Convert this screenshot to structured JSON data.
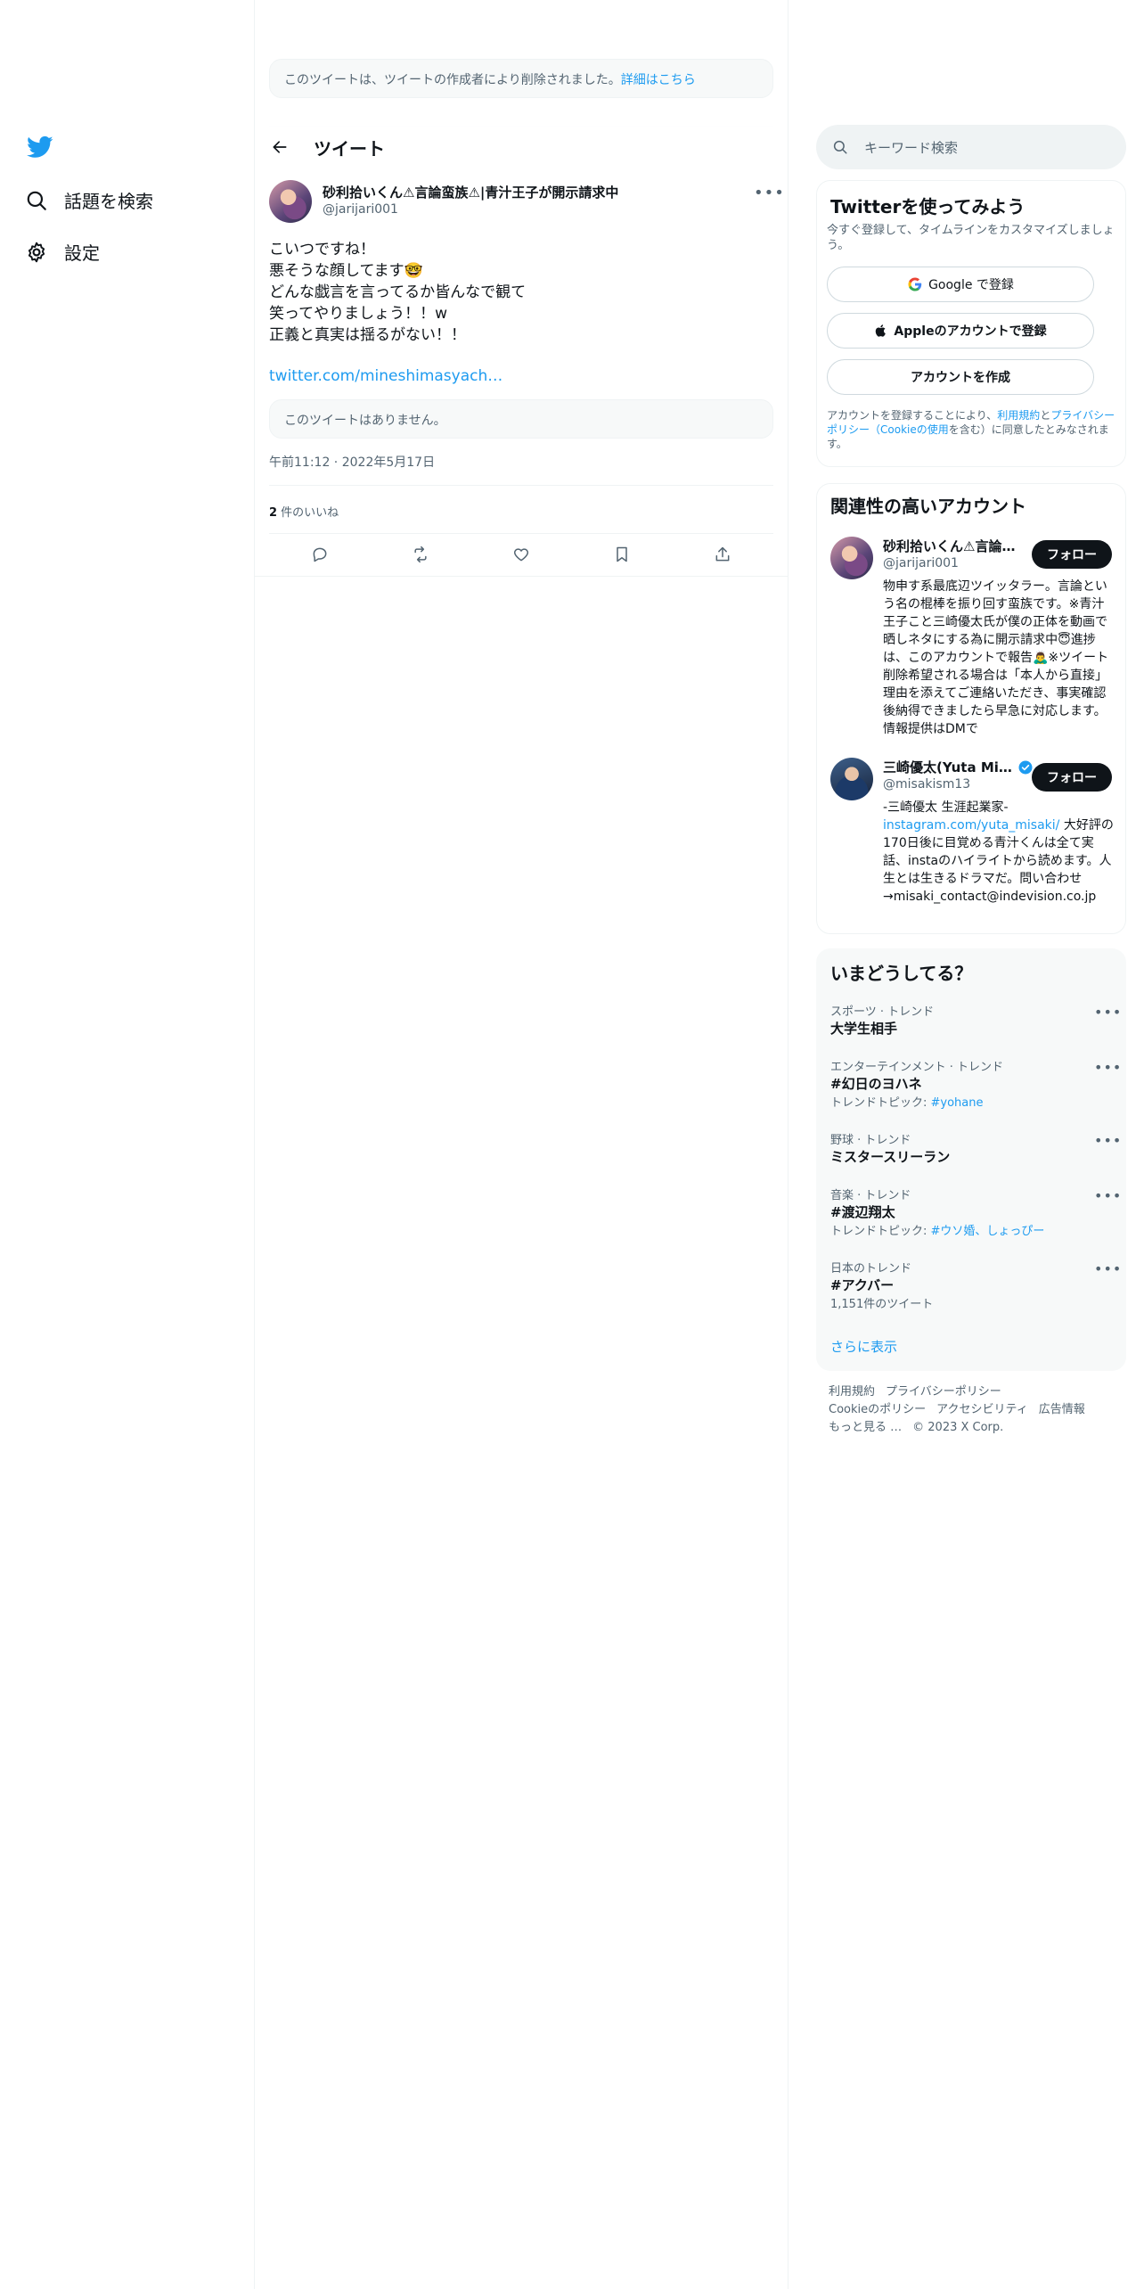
{
  "nav": {
    "logo_icon": "twitter-bird-icon",
    "items": [
      {
        "label": "話題を検索",
        "icon": "search-icon"
      },
      {
        "label": "設定",
        "icon": "gear-icon"
      }
    ]
  },
  "deleted_banner": {
    "text": "このツイートは、ツイートの作成者により削除されました。",
    "link": "詳細はこちら"
  },
  "header": {
    "title": "ツイート"
  },
  "tweet": {
    "author_name": "砂利拾いくん⚠言論蛮族⚠|青汁王子が開示請求中",
    "author_handle": "@jarijari001",
    "body": "こいつですね！\n悪そうな顔してます🤓\nどんな戯言を言ってるか皆んなで観て\n笑ってやりましょう！！w\n正義と真実は揺るがない！！",
    "link": "twitter.com/mineshimasyach…",
    "quote_unavailable": "このツイートはありません。",
    "time": "午前11:12",
    "date": "2022年5月17日",
    "likes_count": "2",
    "likes_label": " 件のいいね"
  },
  "search": {
    "placeholder": "キーワード検索"
  },
  "signup": {
    "title": "Twitterを使ってみよう",
    "subtitle": "今すぐ登録して、タイムラインをカスタマイズしましょう。",
    "google_label": "Google で登録",
    "apple_label": "Appleのアカウントで登録",
    "create_label": "アカウントを作成",
    "legal_1": "アカウントを登録することにより、",
    "legal_terms": "利用規約",
    "legal_2": "と",
    "legal_privacy": "プライバシーポリシー（Cookieの使用",
    "legal_3": "を含む）に同意したとみなされます。"
  },
  "relevant": {
    "title": "関連性の高いアカウント",
    "follow_label": "フォロー",
    "accounts": [
      {
        "name": "砂利拾いくん⚠言論…",
        "handle": "@jarijari001",
        "bio": "物申す系最底辺ツイッタラー。言論という名の棍棒を振り回す蛮族です。※青汁王子こと三崎優太氏が僕の正体を動画で晒しネタにする為に開示請求中😇進捗は、このアカウントで報告🙇‍♂️※ツイート削除希望される場合は「本人から直接」理由を添えてご連絡いただき、事実確認後納得できましたら早急に対応します。情報提供はDMで"
      },
      {
        "name": "三崎優太(Yuta Mi…",
        "handle": "@misakism13",
        "verified": true,
        "bio_1": "-三崎優太 生涯起業家-",
        "bio_link": "instagram.com/yuta_misaki/",
        "bio_2": " 大好評の170日後に目覚める青汁くんは全て実話、instaのハイライトから読めます。人生とは生きるドラマだ。問い合わせ→misaki_contact@indevision.co.jp"
      }
    ]
  },
  "trends": {
    "title": "いまどうしてる？",
    "items": [
      {
        "category": "スポーツ · トレンド",
        "name": "大学生相手",
        "sub": ""
      },
      {
        "category": "エンターテインメント · トレンド",
        "name": "#幻日のヨハネ",
        "sub_prefix": "トレンドトピック: ",
        "sub_link": "#yohane"
      },
      {
        "category": "野球 · トレンド",
        "name": "ミスタースリーラン",
        "sub": ""
      },
      {
        "category": "音楽 · トレンド",
        "name": "#渡辺翔太",
        "sub_prefix": "トレンドトピック: ",
        "sub_link": "#ウソ婚、しょっぴー"
      },
      {
        "category": "日本のトレンド",
        "name": "#アクバー",
        "sub": "1,151件のツイート"
      }
    ],
    "show_more": "さらに表示"
  },
  "footer": {
    "links_row1": [
      "利用規約",
      "プライバシーポリシー"
    ],
    "links_row2": [
      "Cookieのポリシー",
      "アクセシビリティ",
      "広告情報"
    ],
    "more": "もっと見る …",
    "copyright": "© 2023 X Corp."
  },
  "colors": {
    "accent": "#1d9bf0",
    "text": "#0f1419",
    "muted": "#536471",
    "border": "#eff3f4"
  }
}
